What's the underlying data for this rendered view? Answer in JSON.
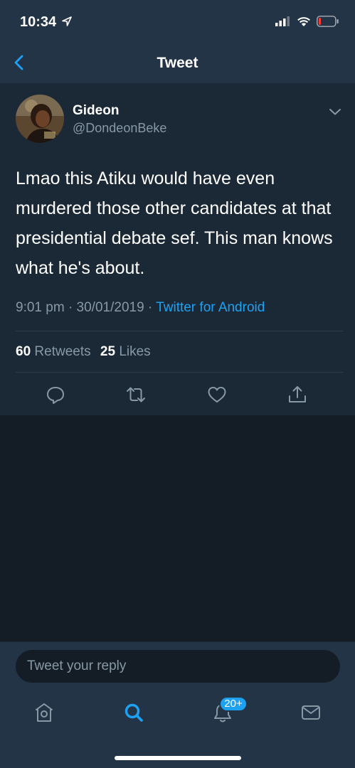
{
  "status_bar": {
    "time": "10:34"
  },
  "nav": {
    "title": "Tweet"
  },
  "tweet": {
    "author_name": "Gideon",
    "author_handle": "@DondeonBeke",
    "text": "Lmao this Atiku would have even murdered those other candidates at that presidential debate sef. This man knows what he's about.",
    "time": "9:01 pm",
    "date": "30/01/2019",
    "source": "Twitter for Android",
    "retweet_count": "60",
    "retweet_label": "Retweets",
    "like_count": "25",
    "like_label": "Likes"
  },
  "reply": {
    "placeholder": "Tweet your reply"
  },
  "tabbar": {
    "notifications_badge": "20+"
  },
  "colors": {
    "accent": "#1da1f2",
    "background": "#141d26",
    "card": "#1b2836",
    "muted": "#8899a6"
  },
  "icons": [
    "back-arrow-icon",
    "chevron-down-icon",
    "reply-icon",
    "retweet-icon",
    "like-icon",
    "share-icon",
    "home-icon",
    "search-icon",
    "notifications-icon",
    "messages-icon"
  ]
}
